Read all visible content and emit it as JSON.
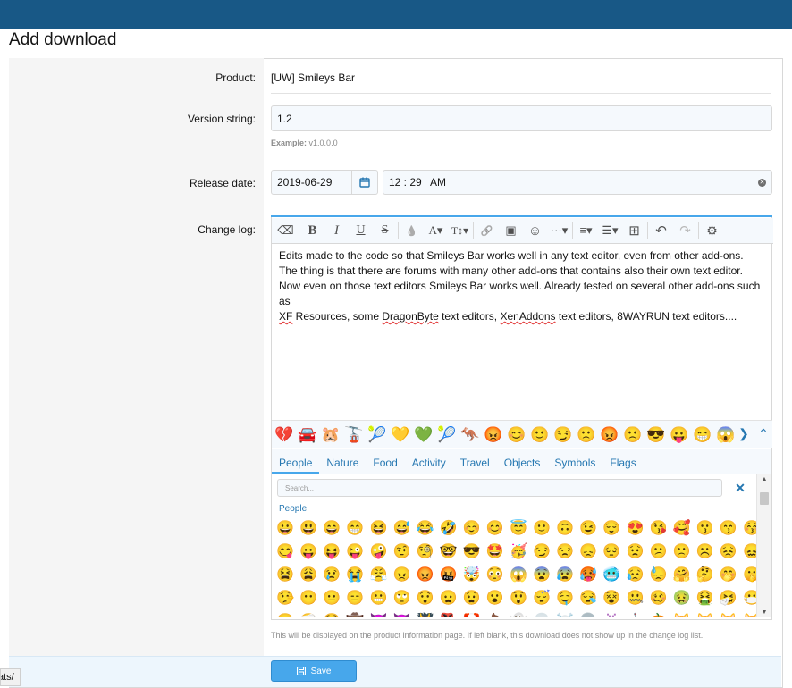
{
  "page": {
    "title": "Add download"
  },
  "form": {
    "product_label": "Product:",
    "product_value": "[UW] Smileys Bar",
    "version_label": "Version string:",
    "version_value": "1.2",
    "version_hint_label": "Example:",
    "version_hint_value": "v1.0.0.0",
    "release_label": "Release date:",
    "release_date": "2019-06-29",
    "release_time": "12 : 29   AM",
    "changelog_label": "Change log:",
    "changelog_help": "This will be displayed on the product information page. If left blank, this download does not show up in the change log list.",
    "save_label": "Save"
  },
  "editor": {
    "lines": [
      {
        "parts": [
          {
            "t": "Edits made to the code so that Smileys Bar works well in any text editor, even from other add-ons."
          }
        ]
      },
      {
        "parts": [
          {
            "t": "The thing is that there are forums with many other add-ons that contains also their own text editor."
          }
        ]
      },
      {
        "parts": [
          {
            "t": "Now even on those text editors Smileys Bar works well. Already tested on several other add-ons such as"
          }
        ]
      },
      {
        "parts": [
          {
            "t": "XF",
            "sp": true
          },
          {
            "t": " Resources, some "
          },
          {
            "t": "DragonByte",
            "sp": true
          },
          {
            "t": " text editors, "
          },
          {
            "t": "XenAddons",
            "sp": true
          },
          {
            "t": " text editors, 8WAYRUN text editors...."
          }
        ]
      }
    ],
    "toolbar": [
      {
        "icon": "eraser-icon",
        "glyph": "⌫"
      },
      {
        "sep": true
      },
      {
        "icon": "bold-icon",
        "glyph": "B",
        "style": "font-weight:bold;font-family:'Liberation Serif',serif;font-size:15px"
      },
      {
        "icon": "italic-icon",
        "glyph": "I",
        "style": "font-style:italic;font-family:'Liberation Serif',serif;font-size:15px"
      },
      {
        "icon": "underline-icon",
        "glyph": "U",
        "style": "text-decoration:underline;font-family:'Liberation Serif',serif;font-size:14px"
      },
      {
        "icon": "strikethrough-icon",
        "glyph": "S",
        "style": "text-decoration:line-through;font-family:'Liberation Serif',serif;font-size:14px"
      },
      {
        "sep": true
      },
      {
        "icon": "text-color-icon",
        "glyph": "💧",
        "style": "font-size:11px;filter:grayscale(1)"
      },
      {
        "icon": "font-family-icon",
        "glyph": "A▾",
        "style": "font-family:'Liberation Serif',serif;font-size:13px"
      },
      {
        "icon": "font-size-icon",
        "glyph": "T↕▾",
        "style": "font-family:'Liberation Serif',serif;font-size:12px"
      },
      {
        "sep": true
      },
      {
        "icon": "link-icon",
        "glyph": "🔗",
        "style": "font-size:11px;filter:grayscale(1)"
      },
      {
        "icon": "image-icon",
        "glyph": "▣"
      },
      {
        "icon": "smilie-icon",
        "glyph": "☺",
        "style": "font-size:15px"
      },
      {
        "icon": "more-insert-icon",
        "glyph": "···▾"
      },
      {
        "sep": true
      },
      {
        "icon": "align-icon",
        "glyph": "≡▾"
      },
      {
        "icon": "list-icon",
        "glyph": "☰▾"
      },
      {
        "icon": "table-icon",
        "glyph": "⊞",
        "style": "font-size:15px"
      },
      {
        "sep": true
      },
      {
        "icon": "undo-icon",
        "glyph": "↶",
        "style": "font-size:15px"
      },
      {
        "icon": "redo-icon",
        "glyph": "↷",
        "style": "font-size:15px;color:#b8b8b8"
      },
      {
        "sep": true
      },
      {
        "icon": "settings-icon",
        "glyph": "⚙",
        "style": "font-size:14px"
      }
    ],
    "smiley_bar": [
      "💔",
      "🚘",
      "🐹",
      "🚡",
      "🎾",
      "💛",
      "💚",
      "🎾",
      "🦘",
      "😡",
      "😊",
      "🙂",
      "😏",
      "🙁",
      "😡",
      "🙁",
      "😎",
      "😛",
      "😁",
      "😱"
    ],
    "tabs": [
      "People",
      "Nature",
      "Food",
      "Activity",
      "Travel",
      "Objects",
      "Symbols",
      "Flags"
    ],
    "active_tab": "People",
    "search_placeholder": "Search...",
    "category": "People",
    "emoji_rows": [
      [
        "😀",
        "😃",
        "😄",
        "😁",
        "😆",
        "😅",
        "😂",
        "🤣",
        "☺️",
        "😊",
        "😇",
        "🙂",
        "🙃",
        "😉",
        "😌",
        "😍",
        "😘",
        "🥰",
        "😗",
        "😙",
        "😚"
      ],
      [
        "😋",
        "😛",
        "😝",
        "😜",
        "🤪",
        "🤨",
        "🧐",
        "🤓",
        "😎",
        "🤩",
        "🥳",
        "😏",
        "😒",
        "😞",
        "😔",
        "😟",
        "😕",
        "🙁",
        "☹️",
        "😣",
        "😖"
      ],
      [
        "😫",
        "😩",
        "😢",
        "😭",
        "😤",
        "😠",
        "😡",
        "🤬",
        "🤯",
        "😳",
        "😱",
        "😨",
        "😰",
        "🥵",
        "🥶",
        "😥",
        "😓",
        "🤗",
        "🤔",
        "🤭",
        "🤫"
      ],
      [
        "🤥",
        "😶",
        "😐",
        "😑",
        "😬",
        "🙄",
        "😯",
        "😦",
        "😧",
        "😮",
        "😲",
        "😴",
        "🤤",
        "😪",
        "😵",
        "🤐",
        "🥴",
        "🤢",
        "🤮",
        "🤧",
        "😷"
      ],
      [
        "🤒",
        "🤕",
        "🤑",
        "🤠",
        "😈",
        "👿",
        "👹",
        "👺",
        "🤡",
        "💩",
        "👻",
        "💀",
        "☠️",
        "👽",
        "👾",
        "🤖",
        "🎃",
        "😺",
        "😸",
        "😹",
        "😻"
      ]
    ]
  }
}
